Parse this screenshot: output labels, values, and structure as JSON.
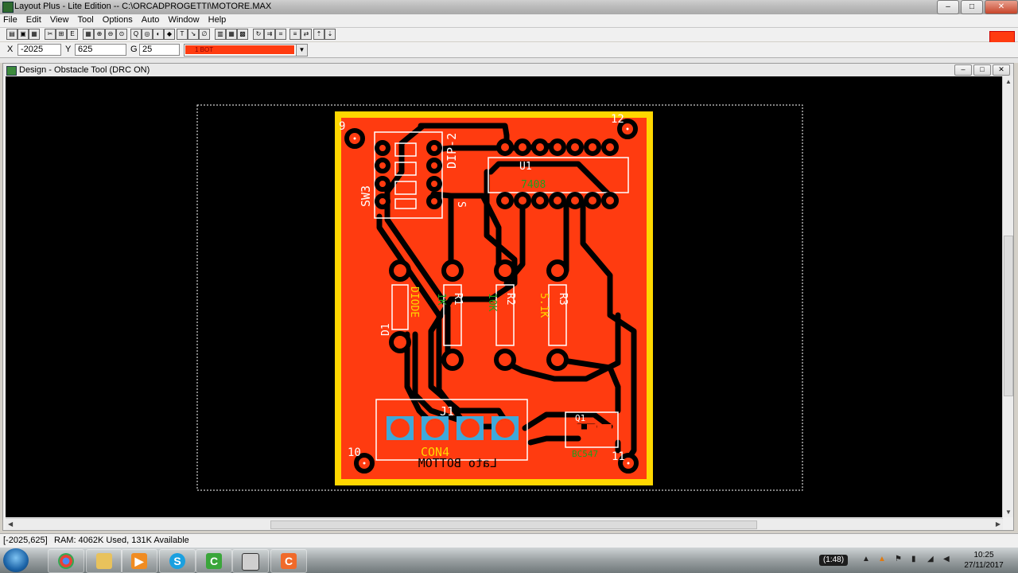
{
  "window": {
    "title": "Layout Plus - Lite Edition -- C:\\ORCADPROGETTI\\MOTORE.MAX",
    "minimize": "–",
    "maximize": "□",
    "close": "✕"
  },
  "menu": [
    "File",
    "Edit",
    "View",
    "Tool",
    "Options",
    "Auto",
    "Window",
    "Help"
  ],
  "coords": {
    "x_label": "X",
    "x_value": "-2025",
    "y_label": "Y",
    "y_value": "625",
    "g_label": "G",
    "g_value": "25",
    "layer": "1 BOT",
    "layer_color": "#ff3b10"
  },
  "child": {
    "title": "Design - Obstacle Tool (DRC ON)"
  },
  "board": {
    "copper_color": "#ff3b10",
    "outline_color": "#ffd700",
    "trace_color": "#000000",
    "labels": {
      "corner_tl": "9",
      "corner_tr": "12",
      "corner_bl": "10",
      "corner_br": "11",
      "dip": "DIP-2",
      "sw3": "SW3",
      "sw_s": "S",
      "u1": "U1",
      "u1_value": "7408",
      "r1": "R1",
      "r1_value": "1K",
      "r2": "R2",
      "r2_value": "10K",
      "r3": "R3",
      "r3_value": "5.1K",
      "d1": "D1",
      "d1_value": "DIODE",
      "j1": "J1",
      "j1_value": "CON4",
      "q1": "Q1",
      "q1_value": "BC547",
      "bottom_text": "Lato BOTTOM"
    }
  },
  "status": {
    "position": "[-2025,625]",
    "ram": "RAM: 4062K Used, 131K Available"
  },
  "taskbar": {
    "battery": "(1:48)",
    "time": "10:25",
    "date": "27/11/2017",
    "apps": [
      "chrome-icon",
      "folder-icon",
      "media-player-icon",
      "skype-icon",
      "camtasia-icon",
      "orcad-layout-icon",
      "camtasia-recorder-icon"
    ]
  }
}
